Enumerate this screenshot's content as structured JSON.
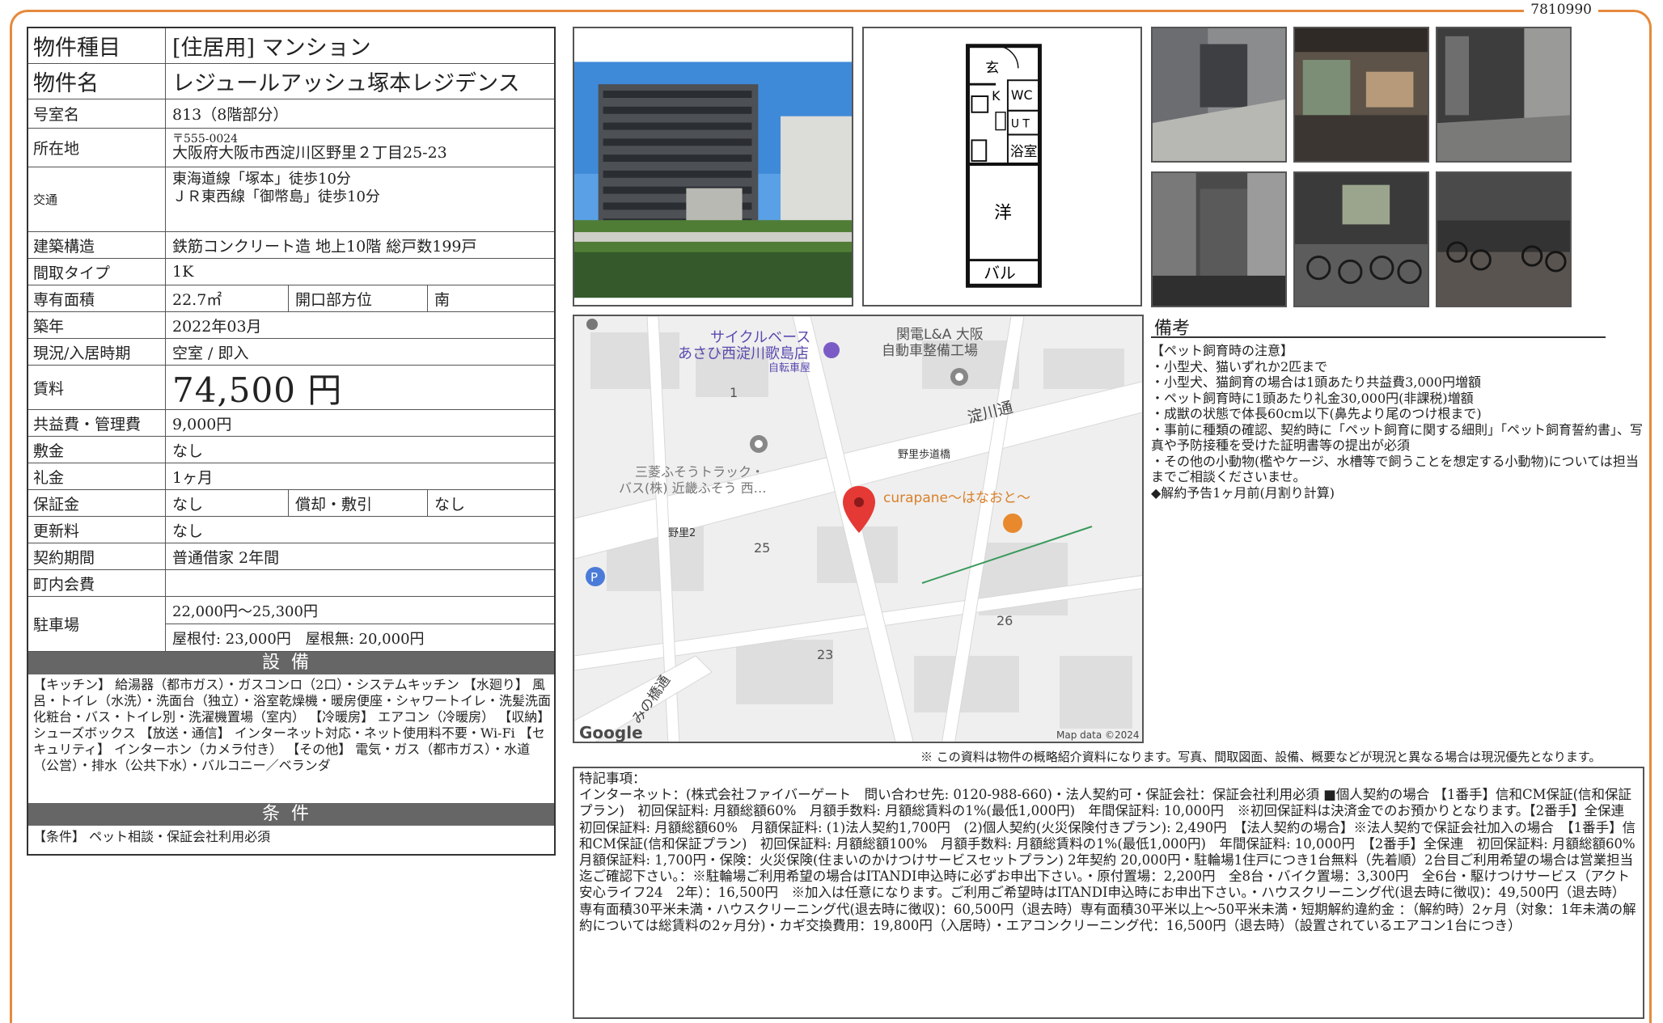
{
  "ref_no": "7810990",
  "property": {
    "type_label": "物件種目",
    "type_value": "[住居用] マンション",
    "name_label": "物件名",
    "name_value": "レジュールアッシュ塚本レジデンス",
    "room_label": "号室名",
    "room_value": "813（8階部分）",
    "address_label": "所在地",
    "zip": "〒555-0024",
    "address": "大阪府大阪市西淀川区野里２丁目25-23",
    "transport_label": "交通",
    "transport_1": "東海道線「塚本」徒歩10分",
    "transport_2": "ＪＲ東西線「御幣島」徒歩10分",
    "structure_label": "建築構造",
    "structure_value": "鉄筋コンクリート造 地上10階 総戸数199戸",
    "layout_label": "間取タイプ",
    "layout_value": "1K",
    "area_label": "専有面積",
    "area_value": "22.7㎡",
    "direction_label": "開口部方位",
    "direction_value": "南",
    "built_label": "築年",
    "built_value": "2022年03月",
    "status_label": "現況/入居時期",
    "status_value": "空室 / 即入",
    "rent_label": "賃料",
    "rent_value": "74,500 円",
    "fee_label": "共益費・管理費",
    "fee_value": "9,000円",
    "deposit_label": "敷金",
    "deposit_value": "なし",
    "key_money_label": "礼金",
    "key_money_value": "1ヶ月",
    "security_label": "保証金",
    "security_value": "なし",
    "amort_label": "償却・敷引",
    "amort_value": "なし",
    "renewal_label": "更新料",
    "renewal_value": "なし",
    "contract_label": "契約期間",
    "contract_value": "普通借家 2年間",
    "community_label": "町内会費",
    "community_value": "",
    "parking_label": "駐車場",
    "parking_1": "22,000円〜25,300円",
    "parking_2": "屋根付: 23,000円　屋根無: 20,000円"
  },
  "facilities": {
    "title": "設備",
    "text": "【キッチン】 給湯器（都市ガス）・ガスコンロ（2口）・システムキッチン 【水廻り】 風呂・トイレ（水洗）・洗面台（独立）・浴室乾燥機・暖房便座・シャワートイレ・洗髪洗面化粧台・バス・トイレ別・洗濯機置場（室内） 【冷暖房】 エアコン（冷暖房） 【収納】 シューズボックス 【放送・通信】 インターネット対応・ネット使用料不要・Wi-Fi 【セキュリティ】 インターホン（カメラ付き） 【その他】 電気・ガス（都市ガス）・水道（公営）・排水（公共下水）・バルコニー／ベランダ"
  },
  "conditions": {
    "title": "条件",
    "text": "【条件】 ペット相談・保証会社利用必須"
  },
  "floorplan": {
    "entry": "玄",
    "kitchen": "K",
    "wc": "WC",
    "ut": "U T",
    "bath": "浴室",
    "western": "洋",
    "balcony": "バル"
  },
  "map": {
    "poi_1a": "サイクルベース",
    "poi_1b": "あさひ西淀川歌島店",
    "poi_1c": "自転車屋",
    "poi_2a": "関電L&A 大阪",
    "poi_2b": "自動車整備工場",
    "road_1": "淀川通",
    "stop_1": "野里歩道橋",
    "stop_2": "野里2",
    "poi_3a": "三菱ふそうトラック・",
    "poi_3b": "バス(株) 近畿ふそう 西…",
    "poi_4": "curapane〜はなおと〜",
    "block_1": "1",
    "block_25": "25",
    "block_26": "26",
    "block_23": "23",
    "road_2": "みの橋通",
    "brand": "Google",
    "copyright": "Map data ©2024",
    "parking_mark": "P"
  },
  "remarks": {
    "title": "備考",
    "lines": [
      "【ペット飼育時の注意】",
      "・小型犬、猫いずれか2匹まで",
      "・小型犬、猫飼育の場合は1頭あたり共益費3,000円増額",
      "・ペット飼育時に1頭あたり礼金30,000円(非課税)増額",
      "・成獣の状態で体長60cm以下(鼻先より尾のつけ根まで)",
      "・事前に種類の確認、契約時に「ペット飼育に関する細則」「ペット飼育誓約書」、写真や予防接種を受けた証明書等の提出が必須",
      "・その他の小動物(檻やケージ、水槽等で飼うことを想定する小動物)については担当までご相談くださいませ。",
      "◆解約予告1ヶ月前(月割り計算)"
    ]
  },
  "disclaimer": "※ この資料は物件の概略紹介資料になります。写真、間取図面、設備、概要などが現況と異なる場合は現況優先となります。",
  "notes": {
    "title": "特記事項：",
    "text": "インターネット：(株式会社ファイバーゲート　問い合わせ先: 0120-988-660)・法人契約可・保証会社：保証会社利用必須 ■個人契約の場合 【1番手】信和CM保証(信和保証プラン)　初回保証料: 月額総額60%　月額手数料: 月額総賃料の1%(最低1,000円)　年間保証料: 10,000円　※初回保証料は決済金でのお預かりとなります。【2番手】全保連　初回保証料: 月額総額60%　月額保証料: (1)法人契約1,700円　(2)個人契約(火災保険付きプラン): 2,490円　【法人契約の場合】※法人契約で保証会社加入の場合　【1番手】信和CM保証(信和保証プラン)　初回保証料: 月額総額100%　月額手数料: 月額総賃料の1%(最低1,000円)　年間保証料: 10,000円　【2番手】全保連　初回保証料: 月額総額60%　月額保証料: 1,700円・保険：火災保険(住まいのかけつけサービスセットプラン) 2年契約 20,000円・駐輪場1住戸につき1台無料（先着順）2台目ご利用希望の場合は営業担当迄ご確認下さい。：※駐輪場ご利用希望の場合はITANDI申込時に必ずお申出下さい。・原付置場：2,200円　全8台・バイク置場：3,300円　全6台・駆けつけサービス（アクト安心ライフ24　2年）：16,500円　※加入は任意になります。ご利用ご希望時はITANDI申込時にお申出下さい。・ハウスクリーニング代(退去時に徴収)：49,500円（退去時）専有面積30平米未満・ハウスクリーニング代(退去時に徴収)：60,500円（退去時）専有面積30平米以上〜50平米未満・短期解約違約金 ：（解約時）2ヶ月（対象：1年未満の解約については総賃料の2ヶ月分)・カギ交換費用：19,800円（入居時）・エアコンクリーニング代：16,500円（退去時）（設置されているエアコン1台につき）"
  }
}
